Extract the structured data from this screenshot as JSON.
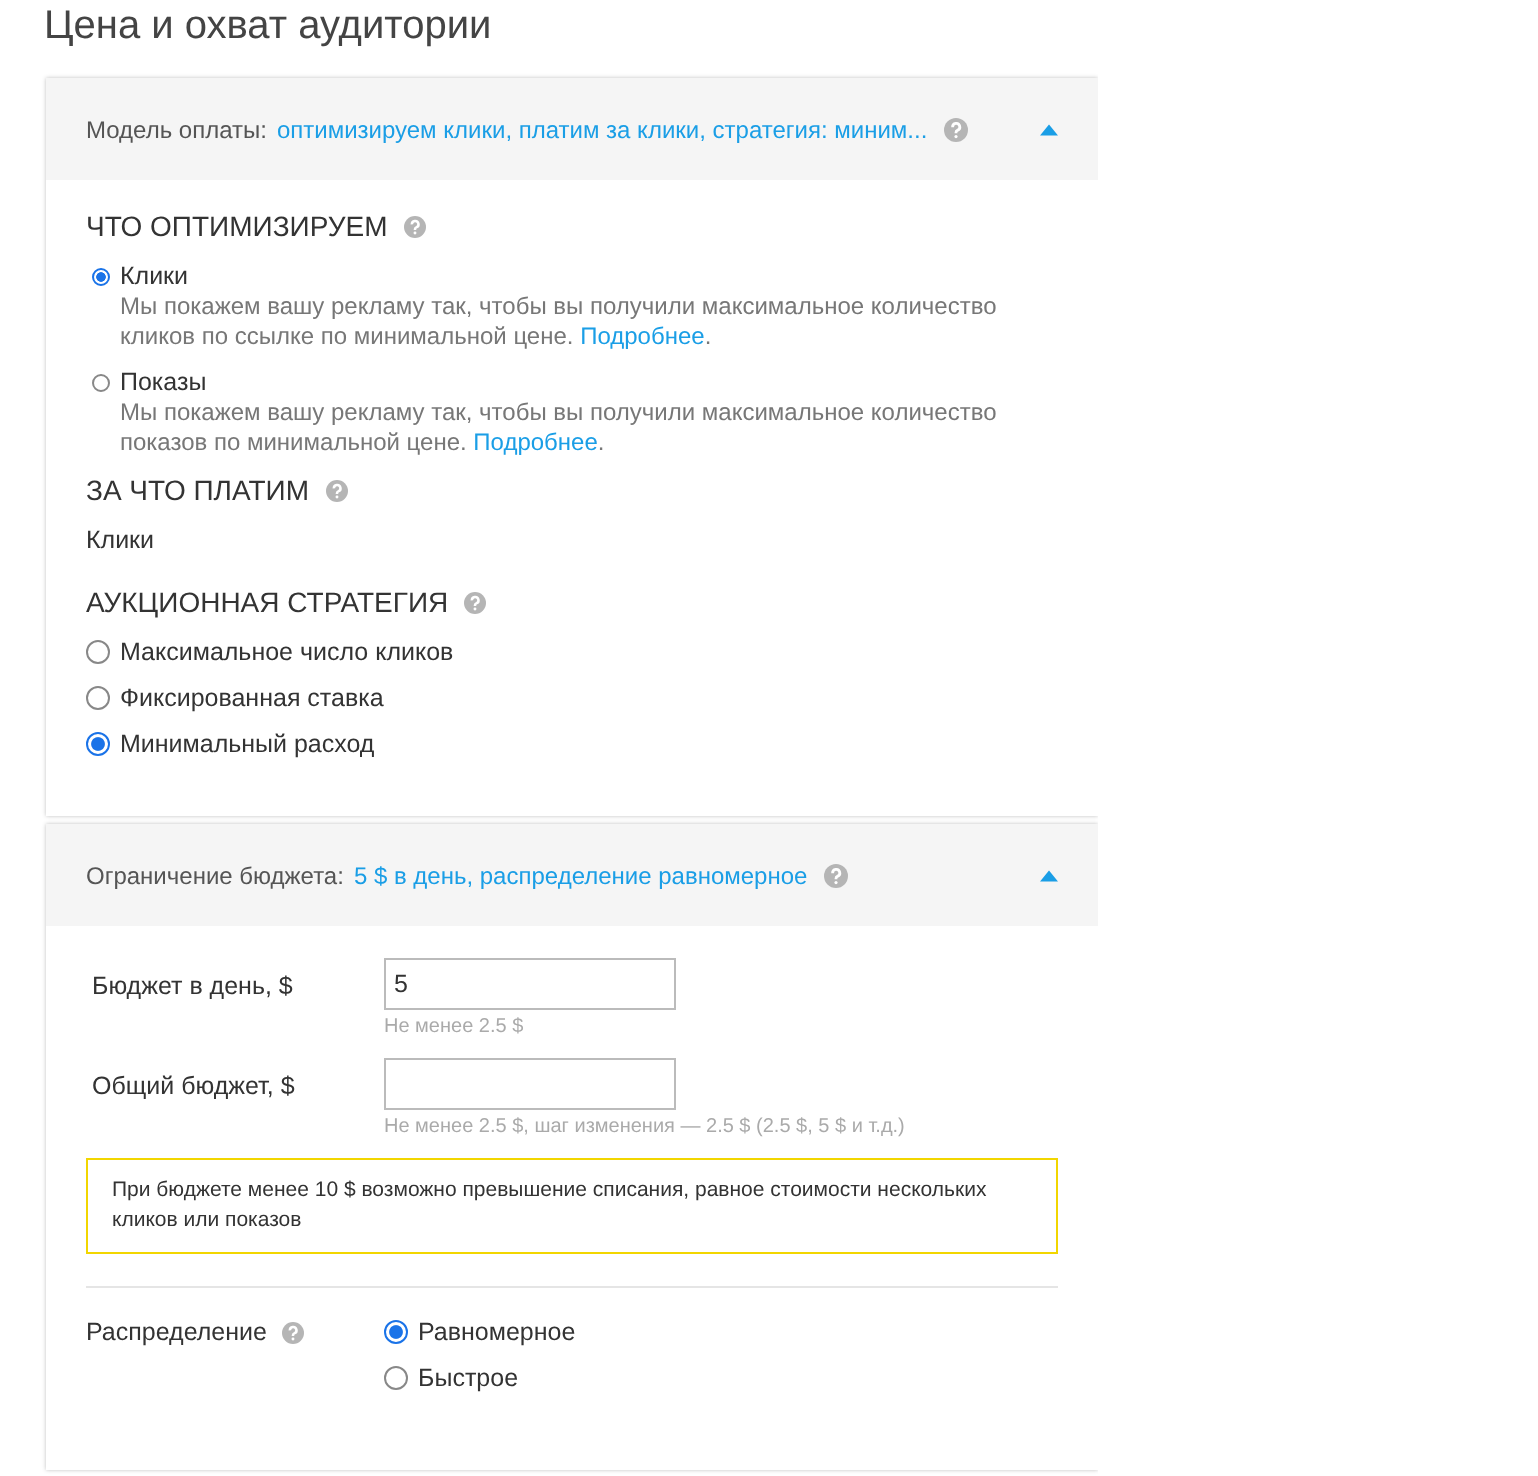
{
  "page_title": "Цена и охват аудитории",
  "payment_panel": {
    "label": "Модель оплаты:",
    "summary": "оптимизируем клики, платим за клики, стратегия: миним...",
    "expanded": true,
    "optimize": {
      "heading": "ЧТО ОПТИМИЗИРУЕМ",
      "options": [
        {
          "label": "Клики",
          "selected": true,
          "description": "Мы покажем вашу рекламу так, чтобы вы получили максимальное количество кликов по ссылке по минимальной цене.",
          "link": "Подробнее",
          "tail": "."
        },
        {
          "label": "Показы",
          "selected": false,
          "description": "Мы покажем вашу рекламу так, чтобы вы получили максимальное количество показов по минимальной цене.",
          "link": "Подробнее",
          "tail": "."
        }
      ]
    },
    "pay_for": {
      "heading": "ЗА ЧТО ПЛАТИМ",
      "value": "Клики"
    },
    "strategy": {
      "heading": "АУКЦИОННАЯ СТРАТЕГИЯ",
      "options": [
        {
          "label": "Максимальное число кликов",
          "selected": false
        },
        {
          "label": "Фиксированная ставка",
          "selected": false
        },
        {
          "label": "Минимальный расход",
          "selected": true
        }
      ]
    }
  },
  "budget_panel": {
    "label": "Ограничение бюджета:",
    "summary": "5 $ в день, распределение равномерное",
    "expanded": true,
    "fields": [
      {
        "label": "Бюджет в день, $",
        "value": "5",
        "hint": "Не менее 2.5 $"
      },
      {
        "label": "Общий бюджет, $",
        "hint": "Не менее 2.5 $, шаг изменения — 2.5 $ (2.5 $, 5 $ и т.д.)"
      }
    ],
    "warning": "При бюджете менее 10 $ возможно превышение списания, равное стоимости нескольких кликов или показов",
    "distribution": {
      "label": "Распределение",
      "options": [
        {
          "label": "Равномерное",
          "selected": true
        },
        {
          "label": "Быстрое",
          "selected": false
        }
      ]
    }
  }
}
